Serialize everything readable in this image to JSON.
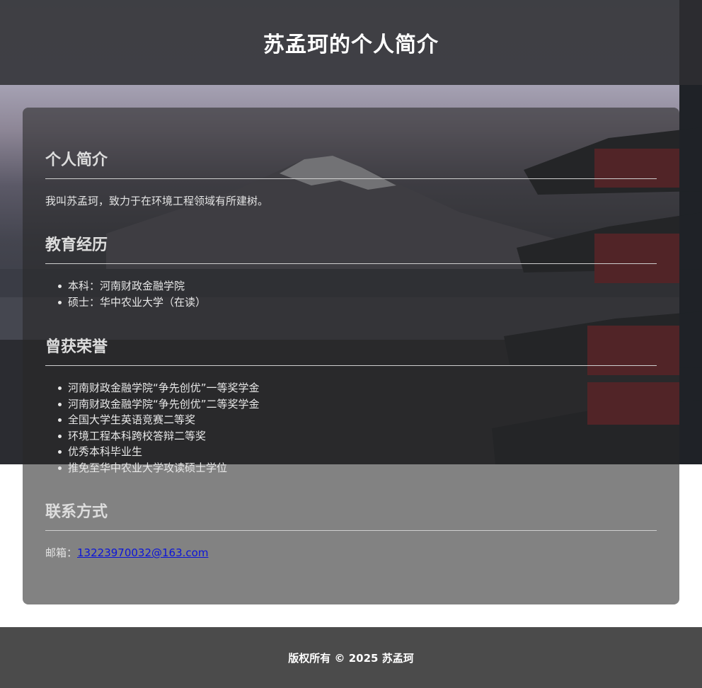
{
  "header": {
    "title": "苏孟珂的个人简介"
  },
  "intro": {
    "heading": "个人简介",
    "text": "我叫苏孟珂，致力于在环境工程领域有所建树。"
  },
  "education": {
    "heading": "教育经历",
    "items": [
      "本科：河南财政金融学院",
      "硕士：华中农业大学（在读）"
    ]
  },
  "honors": {
    "heading": "曾获荣誉",
    "items": [
      "河南财政金融学院“争先创优”一等奖学金",
      "河南财政金融学院“争先创优”二等奖学金",
      "全国大学生英语竞赛二等奖",
      "环境工程本科跨校答辩二等奖",
      "优秀本科毕业生",
      "推免至华中农业大学攻读硕士学位"
    ]
  },
  "contact": {
    "heading": "联系方式",
    "email_label": "邮箱：",
    "email": "13223970032@163.com"
  },
  "footer": {
    "text": "版权所有 © 2025 苏孟珂"
  },
  "colors": {
    "header_bg": "#2e2e32",
    "footer_bg": "#4b4b4b",
    "link": "#0b14d8"
  }
}
